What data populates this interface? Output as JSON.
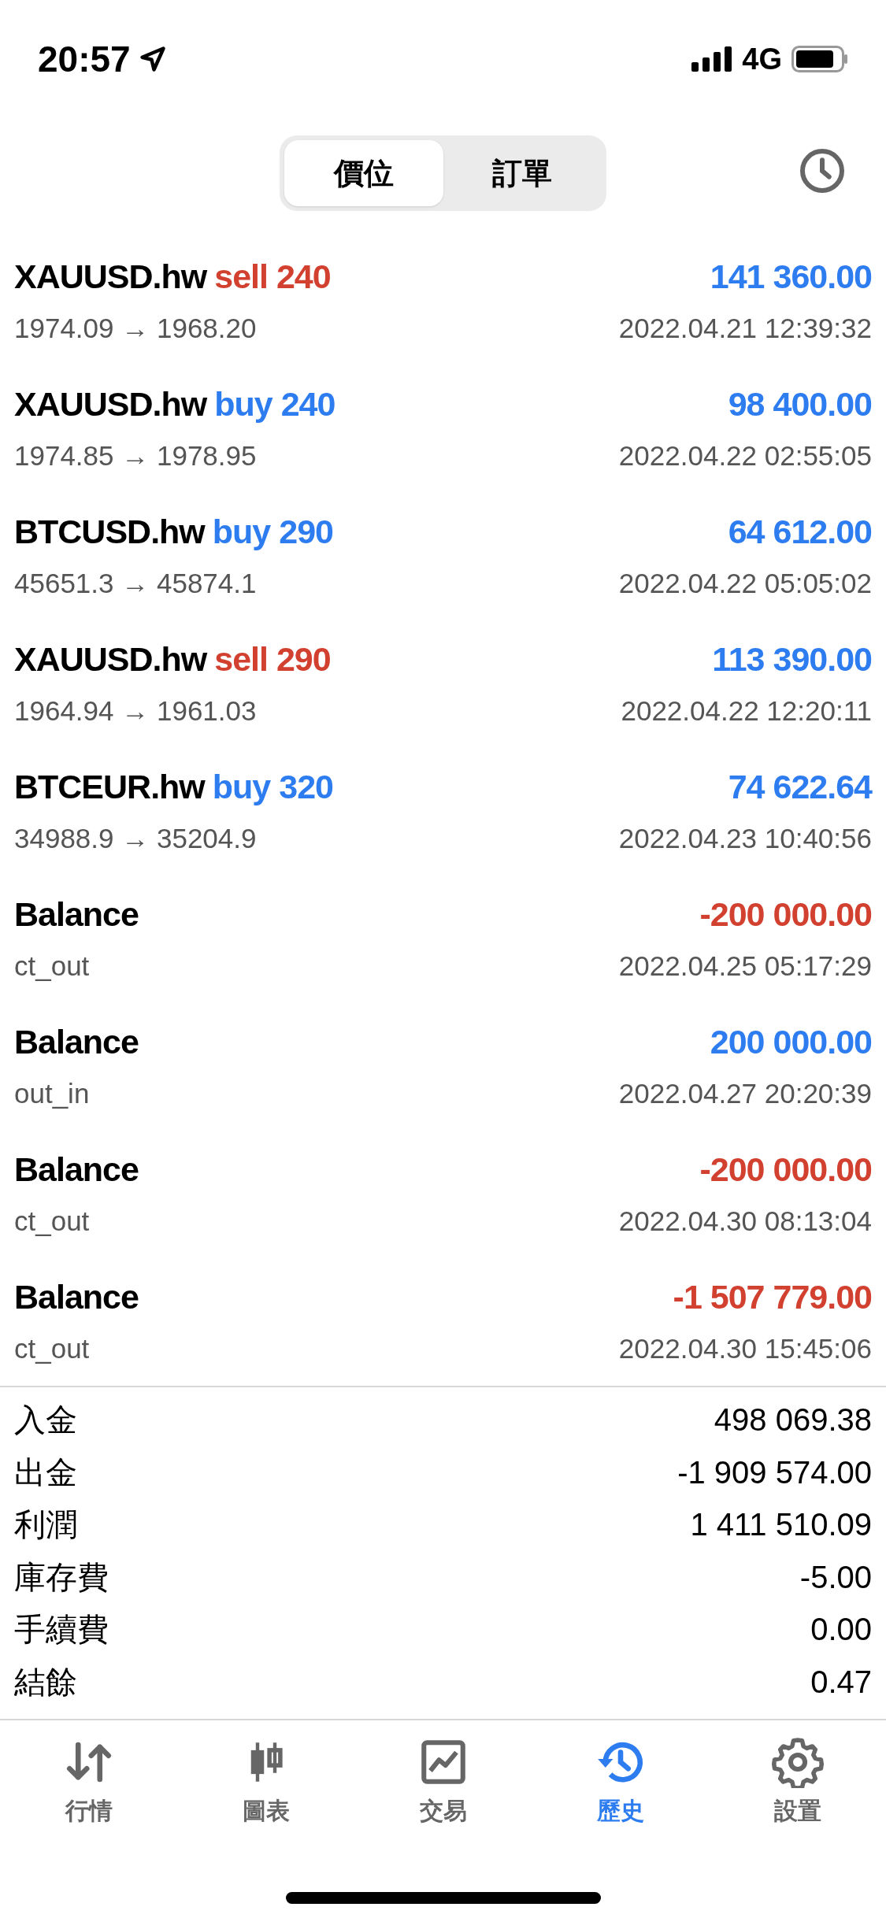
{
  "status_bar": {
    "time": "20:57",
    "network": "4G"
  },
  "segments": [
    {
      "label": "價位",
      "selected": true
    },
    {
      "label": "訂單",
      "selected": false
    }
  ],
  "deals": [
    {
      "symbol": "XAUUSD.hw",
      "order": "sell 240",
      "kind": "sell",
      "prices": "1974.09 → 1968.20",
      "amount": "141 360.00",
      "color": "#2d7cf0",
      "time": "2022.04.21 12:39:32"
    },
    {
      "symbol": "XAUUSD.hw",
      "order": "buy 240",
      "kind": "buy",
      "prices": "1974.85 → 1978.95",
      "amount": "98 400.00",
      "color": "#2d7cf0",
      "time": "2022.04.22 02:55:05"
    },
    {
      "symbol": "BTCUSD.hw",
      "order": "buy 290",
      "kind": "buy",
      "prices": "45651.3 → 45874.1",
      "amount": "64 612.00",
      "color": "#2d7cf0",
      "time": "2022.04.22 05:05:02"
    },
    {
      "symbol": "XAUUSD.hw",
      "order": "sell 290",
      "kind": "sell",
      "prices": "1964.94 → 1961.03",
      "amount": "113 390.00",
      "color": "#2d7cf0",
      "time": "2022.04.22 12:20:11"
    },
    {
      "symbol": "BTCEUR.hw",
      "order": "buy 320",
      "kind": "buy",
      "prices": "34988.9 → 35204.9",
      "amount": "74 622.64",
      "color": "#2d7cf0",
      "time": "2022.04.23 10:40:56"
    },
    {
      "symbol": "Balance",
      "prices": "ct_out",
      "amount": "-200 000.00",
      "color": "#d2402f",
      "time": "2022.04.25 05:17:29"
    },
    {
      "symbol": "Balance",
      "prices": "out_in",
      "amount": "200 000.00",
      "color": "#2d7cf0",
      "time": "2022.04.27 20:20:39"
    },
    {
      "symbol": "Balance",
      "prices": "ct_out",
      "amount": "-200 000.00",
      "color": "#d2402f",
      "time": "2022.04.30 08:13:04"
    },
    {
      "symbol": "Balance",
      "prices": "ct_out",
      "amount": "-1 507 779.00",
      "color": "#d2402f",
      "time": "2022.04.30 15:45:06"
    }
  ],
  "summary": [
    {
      "label": "入金",
      "value": "498 069.38"
    },
    {
      "label": "出金",
      "value": "-1 909 574.00"
    },
    {
      "label": "利潤",
      "value": "1 411 510.09"
    },
    {
      "label": "庫存費",
      "value": "-5.00"
    },
    {
      "label": "手續費",
      "value": "0.00"
    },
    {
      "label": "結餘",
      "value": "0.47"
    }
  ],
  "tab_bar": [
    {
      "label": "行情",
      "selected": false
    },
    {
      "label": "圖表",
      "selected": false
    },
    {
      "label": "交易",
      "selected": false
    },
    {
      "label": "歷史",
      "selected": true
    },
    {
      "label": "設置",
      "selected": false
    }
  ]
}
